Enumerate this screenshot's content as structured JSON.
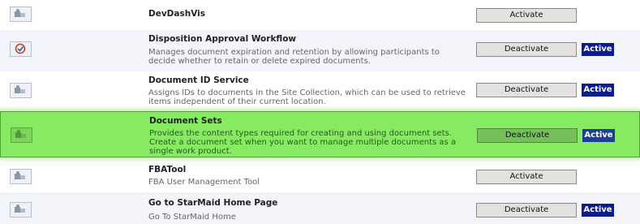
{
  "features": [
    {
      "icon": "feature-puzzle-icon",
      "title": "DevDashVis",
      "description": "",
      "button_label": "Activate",
      "status": ""
    },
    {
      "icon": "feature-checkmark-icon",
      "title": "Disposition Approval Workflow",
      "description": "Manages document expiration and retention by allowing participants to decide whether to retain or delete expired documents.",
      "button_label": "Deactivate",
      "status": "Active"
    },
    {
      "icon": "feature-puzzle-icon",
      "title": "Document ID Service",
      "description": "Assigns IDs to documents in the Site Collection, which can be used to retrieve items independent of their current location.",
      "button_label": "Deactivate",
      "status": "Active"
    },
    {
      "icon": "feature-puzzle-icon",
      "title": "Document Sets",
      "description": "Provides the content types required for creating and using document sets. Create a document set when you want to manage multiple documents as a single work product.",
      "button_label": "Deactivate",
      "status": "Active"
    },
    {
      "icon": "feature-puzzle-icon",
      "title": "FBATool",
      "description": "FBA User Management Tool",
      "button_label": "Activate",
      "status": ""
    },
    {
      "icon": "feature-puzzle-icon",
      "title": "Go to StarMaid Home Page",
      "description": "Go To StarMaid Home",
      "button_label": "Deactivate",
      "status": "Active"
    }
  ],
  "colors": {
    "highlight": "#86ea63",
    "active_badge": "#0a1c8f"
  }
}
